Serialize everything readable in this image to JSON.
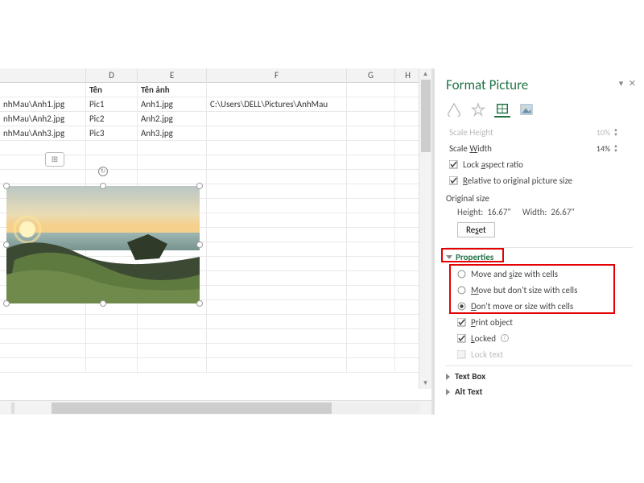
{
  "columns": {
    "D": "D",
    "E": "E",
    "F": "F",
    "G": "G",
    "H": "H"
  },
  "headers": {
    "col_a_partial": "",
    "ten": "Tên",
    "ten_anh": "Tên ảnh",
    "path": ""
  },
  "rows": [
    {
      "a": "nhMau\\Anh1.jpg",
      "d": "Pic1",
      "e": "Anh1.jpg",
      "f": "C:\\Users\\DELL\\Pictures\\AnhMau"
    },
    {
      "a": "nhMau\\Anh2.jpg",
      "d": "Pic2",
      "e": "Anh2.jpg",
      "f": ""
    },
    {
      "a": "nhMau\\Anh3.jpg",
      "d": "Pic3",
      "e": "Anh3.jpg",
      "f": ""
    }
  ],
  "pane": {
    "title": "Format Picture",
    "scale_height_label": "Scale Height",
    "scale_height_value": "10%",
    "scale_width_label": "Scale Width",
    "scale_width_value": "14%",
    "lock_aspect": "Lock aspect ratio",
    "relative": "Relative to original picture size",
    "original_size": "Original size",
    "height_label": "Height:",
    "height_value": "16.67\"",
    "width_label": "Width:",
    "width_value": "26.67\"",
    "reset": "Reset",
    "properties": "Properties",
    "opt1": "Move and size with cells",
    "opt2": "Move but don't size with cells",
    "opt3": "Don't move or size with cells",
    "print": "Print object",
    "locked": "Locked",
    "lock_text": "Lock text",
    "text_box": "Text Box",
    "alt_text": "Alt Text"
  }
}
